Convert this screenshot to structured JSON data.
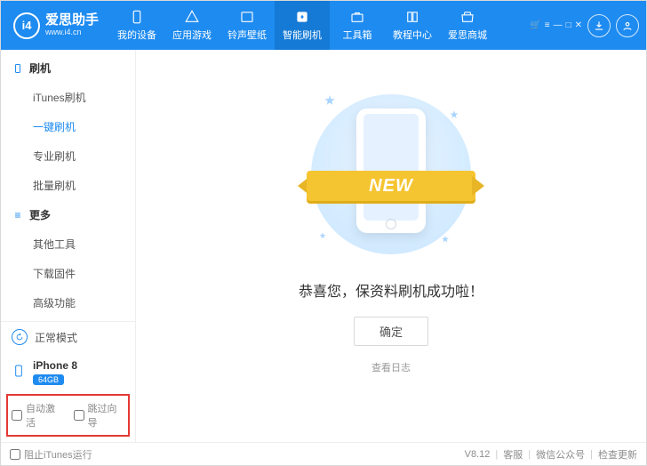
{
  "brand": {
    "name": "爱思助手",
    "url": "www.i4.cn",
    "logo_text": "i4"
  },
  "nav": {
    "items": [
      {
        "label": "我的设备"
      },
      {
        "label": "应用游戏"
      },
      {
        "label": "铃声壁纸"
      },
      {
        "label": "智能刷机"
      },
      {
        "label": "工具箱"
      },
      {
        "label": "教程中心"
      },
      {
        "label": "爱思商城"
      }
    ],
    "active_index": 3
  },
  "sidebar": {
    "groups": [
      {
        "title": "刷机",
        "items": [
          "iTunes刷机",
          "一键刷机",
          "专业刷机",
          "批量刷机"
        ],
        "active_index": 1
      },
      {
        "title": "更多",
        "items": [
          "其他工具",
          "下载固件",
          "高级功能"
        ],
        "active_index": -1
      }
    ],
    "mode": {
      "label": "正常模式"
    },
    "device": {
      "name": "iPhone 8",
      "storage": "64GB"
    },
    "checks": {
      "auto_activate": "自动激活",
      "skip_wizard": "跳过向导"
    }
  },
  "main": {
    "ribbon": "NEW",
    "success": "恭喜您，保资料刷机成功啦！",
    "ok": "确定",
    "view_log": "查看日志"
  },
  "footer": {
    "block_itunes": "阻止iTunes运行",
    "version": "V8.12",
    "links": [
      "客服",
      "微信公众号",
      "检查更新"
    ]
  }
}
